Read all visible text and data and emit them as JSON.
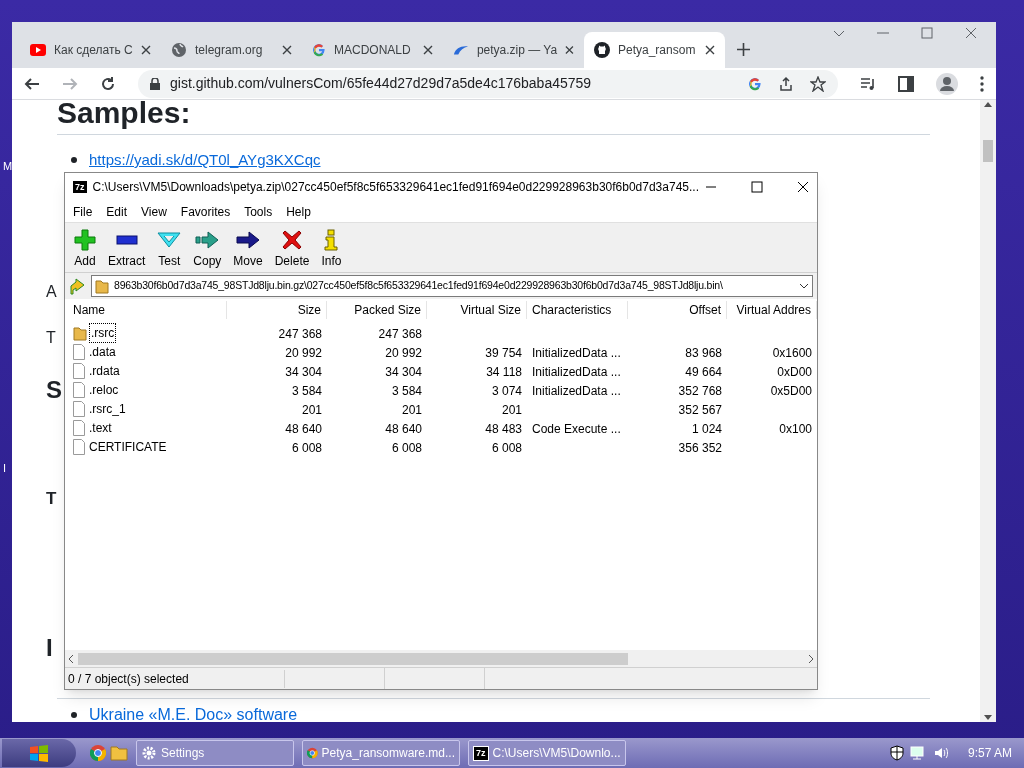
{
  "desktop": {
    "edge_labels": [
      "M",
      "I"
    ]
  },
  "browser": {
    "tabs": [
      {
        "title": "Как сделать С",
        "selected": false
      },
      {
        "title": "telegram.org",
        "selected": false
      },
      {
        "title": "MACDONALD",
        "selected": false
      },
      {
        "title": "petya.zip — Ya",
        "selected": false
      },
      {
        "title": "Petya_ransom",
        "selected": true
      }
    ],
    "url": "gist.github.com/vulnersCom/65fe44d27d29d7a5de4c176baba45759",
    "page": {
      "heading": "Samples:",
      "link": "https://yadi.sk/d/QT0l_AYg3KXCqc",
      "fragments": [
        {
          "kind": "text",
          "text": "A"
        },
        {
          "kind": "text",
          "text": "T"
        },
        {
          "kind": "heading",
          "text": "S"
        },
        {
          "kind": "subheading",
          "text": "T"
        },
        {
          "kind": "heading",
          "text": "I"
        }
      ],
      "bottom_link": "Ukraine «M.E. Doc» software"
    }
  },
  "archiver": {
    "app_icon": "7z",
    "title": "C:\\Users\\VM5\\Downloads\\petya.zip\\027cc450ef5f8c5f653329641ec1fed91f694e0d229928963b30f6b0d7d3a745...",
    "menu": [
      "File",
      "Edit",
      "View",
      "Favorites",
      "Tools",
      "Help"
    ],
    "toolbar": [
      "Add",
      "Extract",
      "Test",
      "Copy",
      "Move",
      "Delete",
      "Info"
    ],
    "path": "8963b30f6b0d7d3a745_98STJd8lju.bin.gz\\027cc450ef5f8c5f653329641ec1fed91f694e0d229928963b30f6b0d7d3a745_98STJd8lju.bin\\",
    "columns": [
      "Name",
      "Size",
      "Packed Size",
      "Virtual Size",
      "Characteristics",
      "Offset",
      "Virtual Addres"
    ],
    "rows": [
      {
        "kind": "folder",
        "focused": true,
        "cells": [
          ".rsrc",
          "247 368",
          "247 368",
          "",
          "",
          "",
          ""
        ]
      },
      {
        "kind": "file",
        "focused": false,
        "cells": [
          ".data",
          "20 992",
          "20 992",
          "39 754",
          "InitializedData ...",
          "83 968",
          "0x1600"
        ]
      },
      {
        "kind": "file",
        "focused": false,
        "cells": [
          ".rdata",
          "34 304",
          "34 304",
          "34 118",
          "InitializedData ...",
          "49 664",
          "0xD00"
        ]
      },
      {
        "kind": "file",
        "focused": false,
        "cells": [
          ".reloc",
          "3 584",
          "3 584",
          "3 074",
          "InitializedData ...",
          "352 768",
          "0x5D00"
        ]
      },
      {
        "kind": "file",
        "focused": false,
        "cells": [
          ".rsrc_1",
          "201",
          "201",
          "201",
          "",
          "352 567",
          ""
        ]
      },
      {
        "kind": "file",
        "focused": false,
        "cells": [
          ".text",
          "48 640",
          "48 640",
          "48 483",
          "Code Execute ...",
          "1 024",
          "0x100"
        ]
      },
      {
        "kind": "file",
        "focused": false,
        "cells": [
          "CERTIFICATE",
          "6 008",
          "6 008",
          "6 008",
          "",
          "356 352",
          ""
        ]
      }
    ],
    "status": "0 / 7 object(s) selected"
  },
  "taskbar": {
    "tasks": [
      {
        "label": "Settings"
      },
      {
        "label": "Petya_ransomware.md..."
      },
      {
        "label": "C:\\Users\\VM5\\Downlo...",
        "app_icon": "7z"
      }
    ],
    "clock": "9:57 AM"
  }
}
